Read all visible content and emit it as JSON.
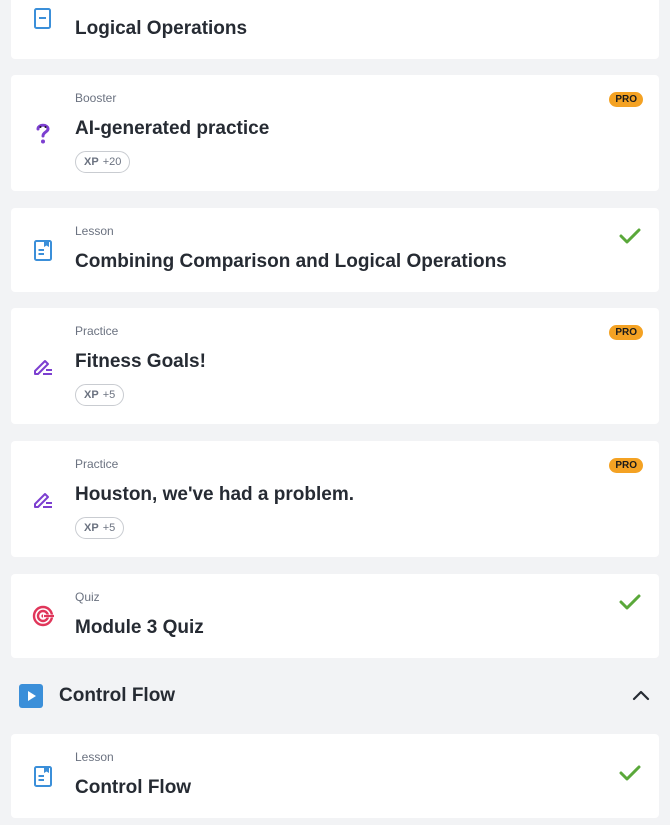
{
  "cards": [
    {
      "title": "Logical Operations",
      "icon": "lesson-icon"
    },
    {
      "kind": "Booster",
      "title": "AI-generated practice",
      "xp_label": "XP",
      "xp_value": "+20",
      "badge": "PRO",
      "icon": "question-mark-icon"
    },
    {
      "kind": "Lesson",
      "title": "Combining Comparison and Logical Operations",
      "status": "completed",
      "icon": "lesson-icon"
    },
    {
      "kind": "Practice",
      "title": "Fitness Goals!",
      "xp_label": "XP",
      "xp_value": "+5",
      "badge": "PRO",
      "icon": "pencil-icon"
    },
    {
      "kind": "Practice",
      "title": "Houston, we've had a problem.",
      "xp_label": "XP",
      "xp_value": "+5",
      "badge": "PRO",
      "icon": "pencil-icon"
    },
    {
      "kind": "Quiz",
      "title": "Module 3 Quiz",
      "status": "completed",
      "icon": "target-icon"
    }
  ],
  "section": {
    "title": "Control Flow",
    "expanded": true,
    "icon": "play-icon"
  },
  "section_cards": [
    {
      "kind": "Lesson",
      "title": "Control Flow",
      "status": "completed",
      "icon": "lesson-icon"
    }
  ],
  "colors": {
    "pro": "#f4a223",
    "check": "#5aa83a",
    "lesson_icon": "#3b8fd9",
    "practice_icon": "#7c3fd0",
    "quiz_icon": "#e0365a"
  }
}
